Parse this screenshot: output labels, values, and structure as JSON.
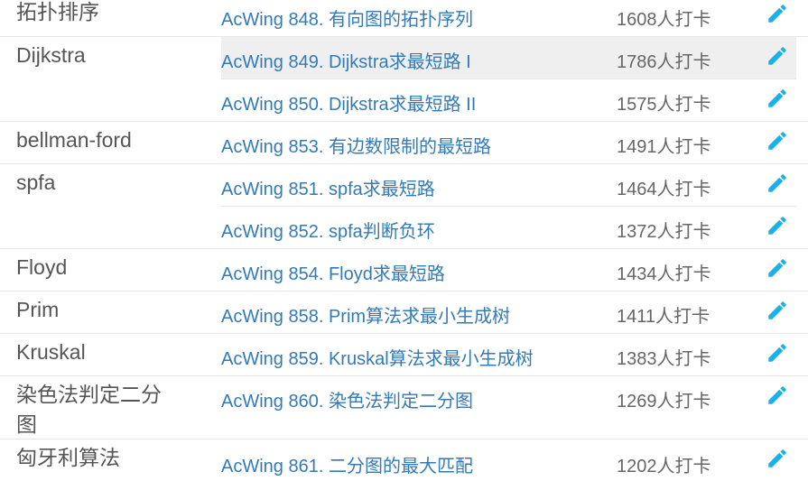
{
  "groups": [
    {
      "category": "拓扑排序",
      "problems": [
        {
          "title": "AcWing 848. 有向图的拓扑序列",
          "count": "1608人打卡"
        }
      ]
    },
    {
      "category": "Dijkstra",
      "problems": [
        {
          "title": "AcWing 849. Dijkstra求最短路 I",
          "count": "1786人打卡"
        },
        {
          "title": "AcWing 850. Dijkstra求最短路 II",
          "count": "1575人打卡"
        }
      ]
    },
    {
      "category": "bellman-ford",
      "problems": [
        {
          "title": "AcWing 853. 有边数限制的最短路",
          "count": "1491人打卡"
        }
      ]
    },
    {
      "category": "spfa",
      "problems": [
        {
          "title": "AcWing 851. spfa求最短路",
          "count": "1464人打卡"
        },
        {
          "title": "AcWing 852. spfa判断负环",
          "count": "1372人打卡"
        }
      ]
    },
    {
      "category": "Floyd",
      "problems": [
        {
          "title": "AcWing 854. Floyd求最短路",
          "count": "1434人打卡"
        }
      ]
    },
    {
      "category": "Prim",
      "problems": [
        {
          "title": "AcWing 858. Prim算法求最小生成树",
          "count": "1411人打卡"
        }
      ]
    },
    {
      "category": "Kruskal",
      "problems": [
        {
          "title": "AcWing 859. Kruskal算法求最小生成树",
          "count": "1383人打卡"
        }
      ]
    },
    {
      "category": "染色法判定二分图",
      "problems": [
        {
          "title": "AcWing 860. 染色法判定二分图",
          "count": "1269人打卡"
        }
      ]
    },
    {
      "category": "匈牙利算法",
      "problems": [
        {
          "title": "AcWing 861. 二分图的最大匹配",
          "count": "1202人打卡"
        }
      ]
    }
  ],
  "icons": {
    "edit": "pencil-icon",
    "edit_color": "#1ab0e8"
  }
}
